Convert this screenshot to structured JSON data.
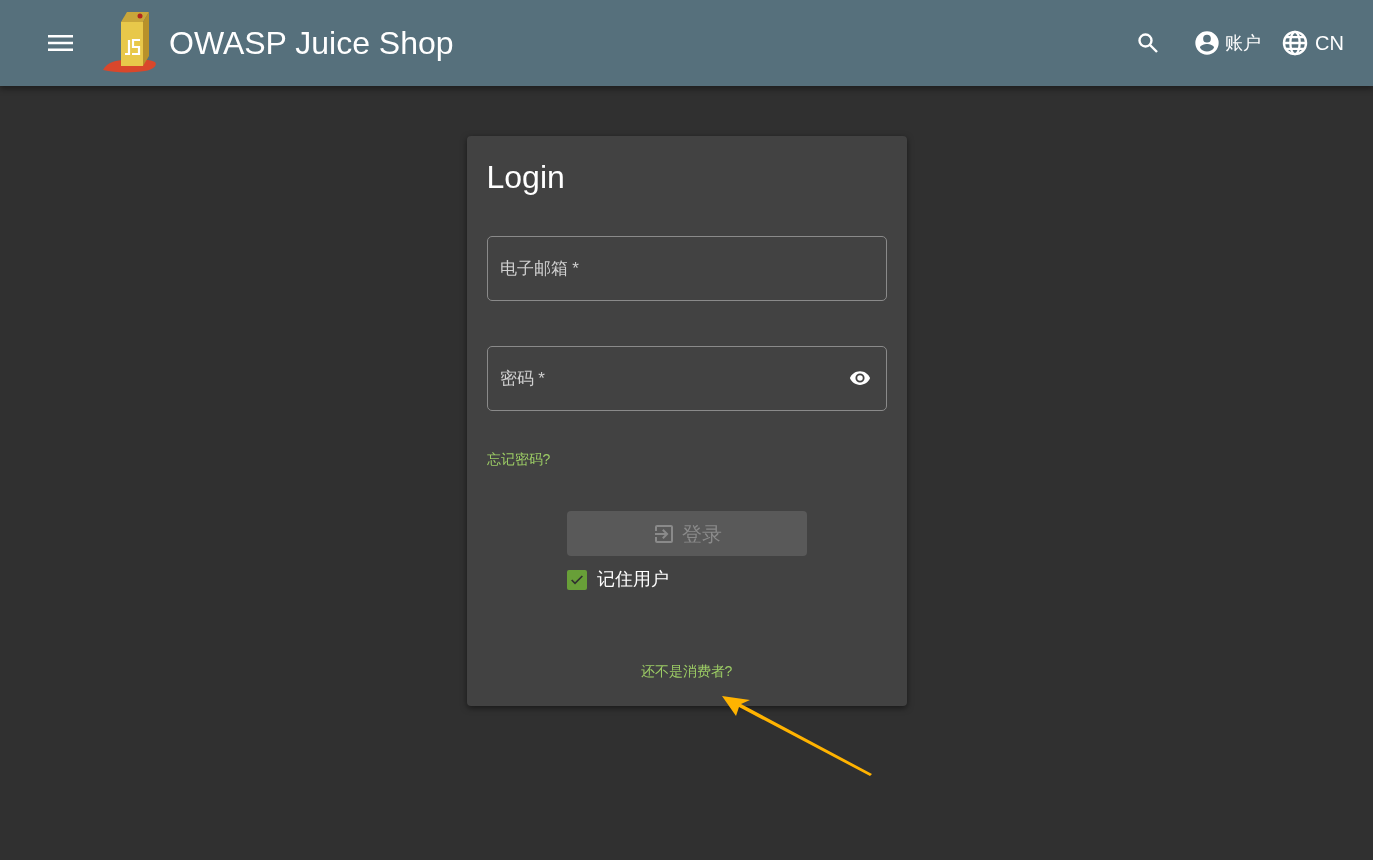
{
  "toolbar": {
    "title": "OWASP Juice Shop",
    "account": "账户",
    "language": "CN"
  },
  "login": {
    "title": "Login",
    "fields": [
      {
        "kind": "email",
        "placeholder": "电子邮箱 *"
      },
      {
        "kind": "password",
        "placeholder": "密码 *"
      }
    ],
    "forgot_link": "忘记密码?",
    "submit": {
      "label": "登录",
      "disabled": true
    },
    "remember": {
      "label": "记住用户",
      "checked": true
    },
    "register_link": "还不是消费者?"
  }
}
